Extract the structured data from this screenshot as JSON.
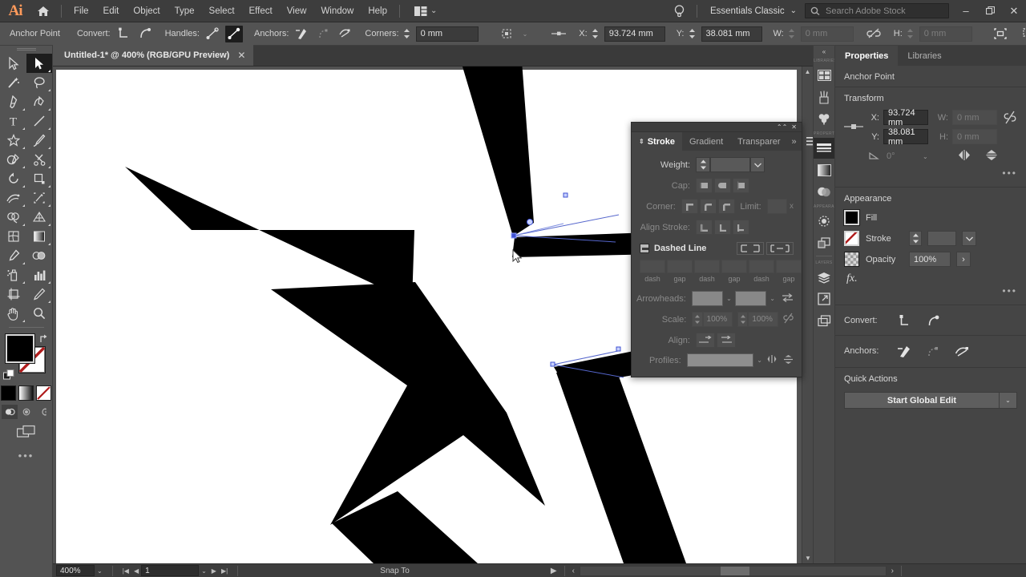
{
  "app": {
    "name": "Adobe Illustrator",
    "logo_text": "Ai"
  },
  "menubar": {
    "items": [
      "File",
      "Edit",
      "Object",
      "Type",
      "Select",
      "Effect",
      "View",
      "Window",
      "Help"
    ],
    "arrange_icon": "arrange-documents-icon",
    "chevron": "⌄",
    "bulb_icon": "discover-bulb-icon",
    "workspace_label": "Essentials Classic",
    "search": {
      "placeholder": "Search Adobe Stock",
      "icon": "search-icon"
    },
    "window_controls": {
      "minimize": "–",
      "restore": "❐",
      "close": "✕"
    }
  },
  "controlbar": {
    "context_label": "Anchor Point",
    "convert_label": "Convert:",
    "convert_icons": [
      "convert-to-corner-icon",
      "convert-to-smooth-icon"
    ],
    "handles_label": "Handles:",
    "handles_icons": [
      "handles-break-icon",
      "handles-join-icon"
    ],
    "anchors_label": "Anchors:",
    "anchors_icons": [
      "remove-anchor-icon",
      "connect-anchor-icon",
      "isolate-anchor-icon"
    ],
    "corners_label": "Corners:",
    "corners_value": "0 mm",
    "align_icon": "align-to-selection-icon",
    "transform_icon": "transform-origin-icon",
    "x_label": "X:",
    "x_value": "93.724 mm",
    "y_label": "Y:",
    "y_value": "38.081 mm",
    "w_label": "W:",
    "w_value": "0 mm",
    "h_label": "H:",
    "h_value": "0 mm",
    "link_icon": "link-broken-icon",
    "shape_icon": "shape-options-icon",
    "doc_setup_icon": "document-setup-icon",
    "more_chevron": "⌄"
  },
  "document_tab": {
    "title": "Untitled-1* @ 400% (RGB/GPU Preview)",
    "close": "✕"
  },
  "toolbar": {
    "tools": [
      {
        "name": "selection-tool",
        "glyph": "sel-outline",
        "selected": false
      },
      {
        "name": "direct-selection-tool",
        "glyph": "sel-solid",
        "selected": true
      },
      {
        "name": "magic-wand-tool",
        "glyph": "wand",
        "selected": false
      },
      {
        "name": "lasso-tool",
        "glyph": "lasso",
        "selected": false
      },
      {
        "name": "pen-tool",
        "glyph": "pen",
        "selected": false
      },
      {
        "name": "curvature-tool",
        "glyph": "curvature",
        "selected": false
      },
      {
        "name": "type-tool",
        "glyph": "type",
        "selected": false
      },
      {
        "name": "line-segment-tool",
        "glyph": "line",
        "selected": false
      },
      {
        "name": "star-rectangle-tool",
        "glyph": "star",
        "selected": false
      },
      {
        "name": "paintbrush-tool",
        "glyph": "brush",
        "selected": false
      },
      {
        "name": "shaper-pencil-tool",
        "glyph": "shaper",
        "selected": false
      },
      {
        "name": "scissors-eraser-tool",
        "glyph": "scissors",
        "selected": false
      },
      {
        "name": "rotate-tool",
        "glyph": "rotate",
        "selected": false
      },
      {
        "name": "scale-tool",
        "glyph": "scale",
        "selected": false
      },
      {
        "name": "width-warp-tool",
        "glyph": "warp",
        "selected": false
      },
      {
        "name": "free-transform-tool",
        "glyph": "freetransform",
        "selected": false
      },
      {
        "name": "shape-builder-tool",
        "glyph": "shapebuilder",
        "selected": false
      },
      {
        "name": "perspective-grid-tool",
        "glyph": "perspective",
        "selected": false
      },
      {
        "name": "mesh-tool",
        "glyph": "mesh",
        "selected": false
      },
      {
        "name": "gradient-tool",
        "glyph": "gradient",
        "selected": false
      },
      {
        "name": "eyedropper-tool",
        "glyph": "eyedropper",
        "selected": false
      },
      {
        "name": "blend-tool",
        "glyph": "blend",
        "selected": false
      },
      {
        "name": "symbol-sprayer-tool",
        "glyph": "sprayer",
        "selected": false
      },
      {
        "name": "column-graph-tool",
        "glyph": "graph",
        "selected": false
      },
      {
        "name": "artboard-tool",
        "glyph": "artboard",
        "selected": false
      },
      {
        "name": "slice-tool",
        "glyph": "slice",
        "selected": false
      },
      {
        "name": "hand-tool",
        "glyph": "hand",
        "selected": false
      },
      {
        "name": "zoom-tool",
        "glyph": "zoom",
        "selected": false
      }
    ],
    "fill_color": "#000000",
    "stroke_color": "#ffffff",
    "swap_icon": "swap-fill-stroke-icon",
    "default_icon": "default-fill-stroke-icon",
    "color_modes": [
      "color-swatch-button",
      "gradient-button",
      "none-button"
    ],
    "draw_modes": [
      "draw-normal-button",
      "draw-behind-button",
      "draw-inside-button"
    ],
    "screen_mode_icon": "change-screen-mode-icon",
    "more_tools": "•••"
  },
  "canvas": {
    "zoom": "400%",
    "cursor": "arrow-cursor",
    "artwork_name": "star-path-artwork"
  },
  "stroke_panel": {
    "tabs": [
      {
        "label": "Stroke",
        "active": true
      },
      {
        "label": "Gradient",
        "active": false
      },
      {
        "label": "Transparer",
        "active": false
      }
    ],
    "overflow": "»",
    "menu_icon": "panel-menu-icon",
    "weight_label": "Weight:",
    "weight_value": "",
    "cap_label": "Cap:",
    "cap_icons": [
      "butt-cap-icon",
      "round-cap-icon",
      "projecting-cap-icon"
    ],
    "corner_label": "Corner:",
    "corner_icons": [
      "miter-join-icon",
      "round-join-icon",
      "bevel-join-icon"
    ],
    "limit_label": "Limit:",
    "limit_value": "",
    "limit_suffix": "x",
    "align_label": "Align Stroke:",
    "align_icons": [
      "align-center-icon",
      "align-inside-icon",
      "align-outside-icon"
    ],
    "dashed_label": "Dashed Line",
    "dash_buttons": [
      "preserve-dash-icon",
      "align-dash-corners-icon"
    ],
    "dash_fields": [
      {
        "label": "dash",
        "value": ""
      },
      {
        "label": "gap",
        "value": ""
      },
      {
        "label": "dash",
        "value": ""
      },
      {
        "label": "gap",
        "value": ""
      },
      {
        "label": "dash",
        "value": ""
      },
      {
        "label": "gap",
        "value": ""
      }
    ],
    "arrowheads_label": "Arrowheads:",
    "swap_arrows_icon": "swap-arrowheads-icon",
    "scale_label": "Scale:",
    "scale_start": "100%",
    "scale_end": "100%",
    "scale_link_icon": "link-scale-icon",
    "align_arrow_label": "Align:",
    "align_arrow_icons": [
      "extend-arrow-beyond-icon",
      "place-arrow-at-end-icon"
    ],
    "profiles_label": "Profiles:",
    "profile_flip_x_icon": "flip-along-icon",
    "profile_flip_y_icon": "flip-across-icon"
  },
  "icon_dock": {
    "collapse": "«",
    "groups": [
      {
        "label": "LIBRARIES",
        "icons": [
          "artboards-icon",
          "brushes-icon",
          "symbols-icon"
        ]
      },
      {
        "label": "PROPERTIES",
        "icons": [
          "stroke-panel-icon",
          "gradient-panel-icon",
          "transparency-panel-icon"
        ]
      },
      {
        "label": "APPEARANCE",
        "icons": [
          "appearance-icon",
          "graphic-styles-icon"
        ]
      },
      {
        "label": "LAYERS",
        "icons": [
          "layers-icon",
          "links-icon",
          "artboards2-icon"
        ]
      }
    ]
  },
  "properties": {
    "tabs": [
      {
        "label": "Properties",
        "active": true
      },
      {
        "label": "Libraries",
        "active": false
      }
    ],
    "context": "Anchor Point",
    "transform": {
      "heading": "Transform",
      "ref_point_icon": "reference-point-icon",
      "x_label": "X:",
      "x_value": "93.724 mm",
      "y_label": "Y:",
      "y_value": "38.081 mm",
      "w_label": "W:",
      "w_value": "0 mm",
      "h_label": "H:",
      "h_value": "0 mm",
      "link_icon": "constrain-proportions-icon",
      "angle_label": "angle-icon",
      "angle_value": "0°",
      "flip_h_icon": "flip-horizontal-icon",
      "flip_v_icon": "flip-vertical-icon",
      "more": "•••"
    },
    "appearance": {
      "heading": "Appearance",
      "fill_label": "Fill",
      "fill_color": "#000000",
      "stroke_label": "Stroke",
      "stroke_weight": "",
      "opacity_label": "Opacity",
      "opacity_value": "100%",
      "opacity_arrow": "›",
      "fx_label": "fx.",
      "more": "•••"
    },
    "convert": {
      "label": "Convert:",
      "icons": [
        "convert-to-corner-icon",
        "convert-to-smooth-icon"
      ]
    },
    "anchors": {
      "label": "Anchors:",
      "icons": [
        "remove-anchor-icon",
        "connect-anchor-icon",
        "isolate-anchor-icon"
      ]
    },
    "quick_actions": {
      "heading": "Quick Actions",
      "button_label": "Start Global Edit",
      "button_arrow": "⌄"
    }
  },
  "statusbar": {
    "zoom_value": "400%",
    "zoom_chevron": "⌄",
    "nav_first": "⏮",
    "nav_prev": "◀",
    "page_value": "1",
    "page_chevron": "⌄",
    "nav_next": "▶",
    "nav_last": "⏭",
    "status_label": "Snap To",
    "status_arrow": "▶",
    "scroll_left": "‹",
    "scroll_right": "›"
  },
  "colors": {
    "panel_bg": "#454545",
    "chrome_bg": "#535353",
    "accent_orange": "#ff9a5b",
    "selection_blue": "#3f51b5",
    "artwork_fill": "#000000"
  }
}
